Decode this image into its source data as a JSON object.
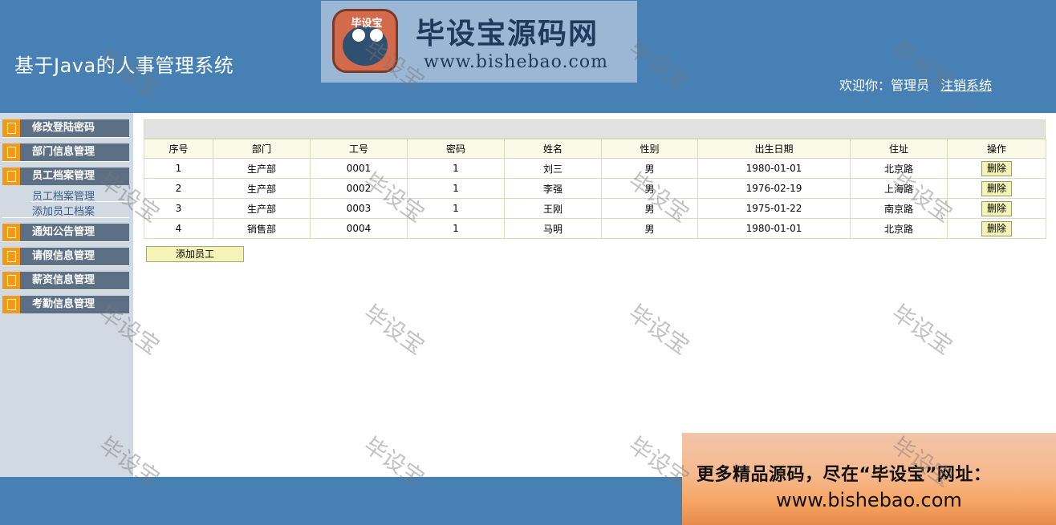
{
  "header": {
    "app_title": "基于Java的人事管理系统",
    "welcome_text": "欢迎你：管理员",
    "logout_link": "注销系统"
  },
  "logo": {
    "badge_text": "毕设宝",
    "main_text": "毕设宝源码网",
    "url_text": "www.bishebao.com"
  },
  "sidebar": {
    "items": [
      {
        "label": "修改登陆密码"
      },
      {
        "label": "部门信息管理"
      },
      {
        "label": "员工档案管理"
      },
      {
        "label": "通知公告管理"
      },
      {
        "label": "请假信息管理"
      },
      {
        "label": "薪资信息管理"
      },
      {
        "label": "考勤信息管理"
      }
    ],
    "sub_items": [
      {
        "label": "员工档案管理"
      },
      {
        "label": "添加员工档案"
      }
    ]
  },
  "table": {
    "columns": [
      "序号",
      "部门",
      "工号",
      "密码",
      "姓名",
      "性别",
      "出生日期",
      "住址",
      "操作"
    ],
    "rows": [
      {
        "no": "1",
        "dept": "生产部",
        "id": "0001",
        "pwd": "1",
        "name": "刘三",
        "gender": "男",
        "birth": "1980-01-01",
        "addr": "北京路",
        "action": "删除"
      },
      {
        "no": "2",
        "dept": "生产部",
        "id": "0002",
        "pwd": "1",
        "name": "李强",
        "gender": "男",
        "birth": "1976-02-19",
        "addr": "上海路",
        "action": "删除"
      },
      {
        "no": "3",
        "dept": "生产部",
        "id": "0003",
        "pwd": "1",
        "name": "王刚",
        "gender": "男",
        "birth": "1975-01-22",
        "addr": "南京路",
        "action": "删除"
      },
      {
        "no": "4",
        "dept": "销售部",
        "id": "0004",
        "pwd": "1",
        "name": "马明",
        "gender": "男",
        "birth": "1980-01-01",
        "addr": "北京路",
        "action": "删除"
      }
    ]
  },
  "add_button": "添加员工",
  "promo": {
    "line1": "更多精品源码，尽在“毕设宝”网址：",
    "line2": "www.bishebao.com"
  },
  "watermark": "毕设宝",
  "colors": {
    "header_bg": "#4680b4",
    "sidebar_bg": "#d1d9e3",
    "menu_bg": "#5d6f85",
    "menu_icon": "#f19a17",
    "button_bg": "#f4f4b8"
  }
}
